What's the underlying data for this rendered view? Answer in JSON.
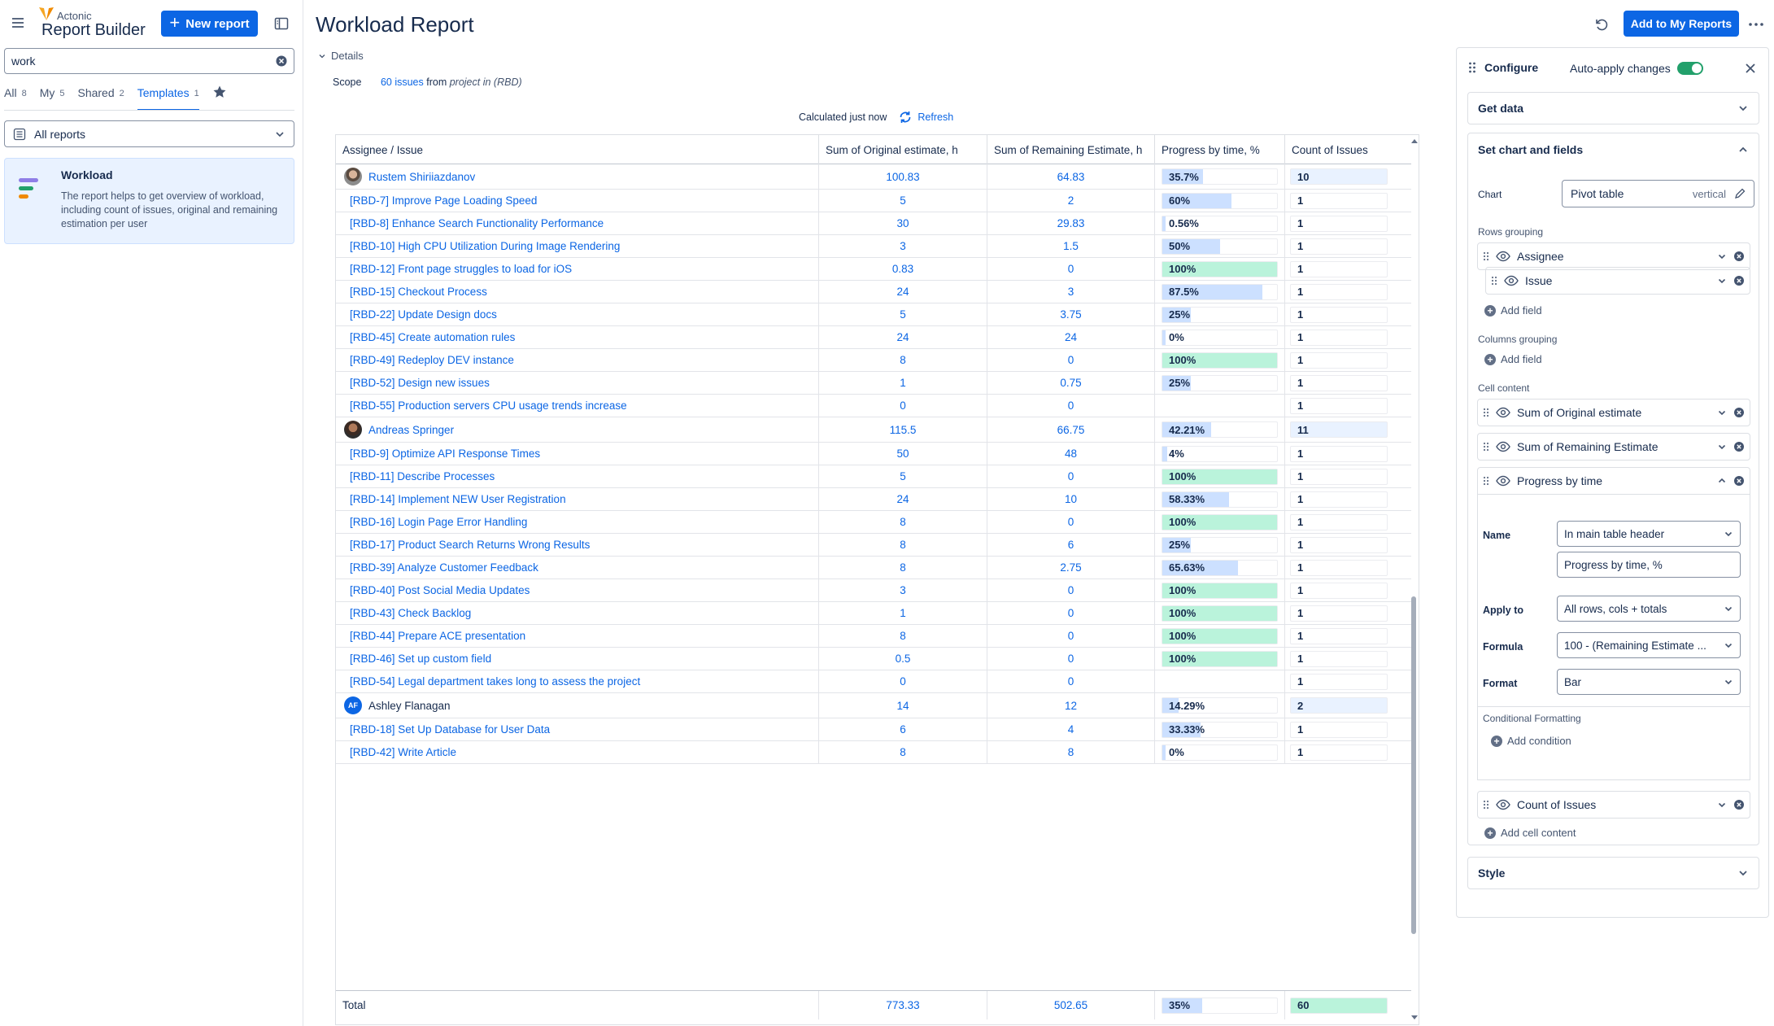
{
  "brand": {
    "small": "Actonic",
    "title": "Report Builder"
  },
  "sidebar": {
    "new_report": "New report",
    "search_value": "work",
    "tabs": [
      {
        "label": "All",
        "count": "8"
      },
      {
        "label": "My",
        "count": "5"
      },
      {
        "label": "Shared",
        "count": "2"
      },
      {
        "label": "Templates",
        "count": "1"
      }
    ],
    "filter": "All reports",
    "card": {
      "title": "Workload",
      "description": "The report helps to get overview of workload, including count of issues, original and remaining estimation per user"
    }
  },
  "header": {
    "title": "Workload Report",
    "add_button": "Add to My Reports",
    "details": "Details",
    "scope_label": "Scope",
    "scope_link": "60 issues",
    "scope_from": "from",
    "scope_project": "project in (RBD)",
    "calculated": "Calculated just now",
    "refresh": "Refresh"
  },
  "table": {
    "columns": [
      "Assignee / Issue",
      "Sum of Original estimate, h",
      "Sum of Remaining Estimate, h",
      "Progress by time, %",
      "Count of Issues"
    ],
    "rows": [
      {
        "type": "assignee",
        "name": "Rustem Shiriiazdanov",
        "avatar": "photo1",
        "orig": "100.83",
        "rem": "64.83",
        "prog": "35.7%",
        "pct": 35.7,
        "count": "10"
      },
      {
        "type": "issue",
        "name": "[RBD-7] Improve Page Loading Speed",
        "orig": "5",
        "rem": "2",
        "prog": "60%",
        "pct": 60,
        "count": "1"
      },
      {
        "type": "issue",
        "name": "[RBD-8] Enhance Search Functionality Performance",
        "orig": "30",
        "rem": "29.83",
        "prog": "0.56%",
        "pct": 0.56,
        "count": "1"
      },
      {
        "type": "issue",
        "name": "[RBD-10] High CPU Utilization During Image Rendering",
        "orig": "3",
        "rem": "1.5",
        "prog": "50%",
        "pct": 50,
        "count": "1"
      },
      {
        "type": "issue",
        "name": "[RBD-12] Front page struggles to load for iOS",
        "orig": "0.83",
        "rem": "0",
        "prog": "100%",
        "pct": 100,
        "count": "1"
      },
      {
        "type": "issue",
        "name": "[RBD-15] Checkout Process",
        "orig": "24",
        "rem": "3",
        "prog": "87.5%",
        "pct": 87.5,
        "count": "1"
      },
      {
        "type": "issue",
        "name": "[RBD-22] Update Design docs",
        "orig": "5",
        "rem": "3.75",
        "prog": "25%",
        "pct": 25,
        "count": "1"
      },
      {
        "type": "issue",
        "name": "[RBD-45] Create automation rules",
        "orig": "24",
        "rem": "24",
        "prog": "0%",
        "pct": 0,
        "count": "1"
      },
      {
        "type": "issue",
        "name": "[RBD-49] Redeploy DEV instance",
        "orig": "8",
        "rem": "0",
        "prog": "100%",
        "pct": 100,
        "count": "1"
      },
      {
        "type": "issue",
        "name": "[RBD-52] Design new issues",
        "orig": "1",
        "rem": "0.75",
        "prog": "25%",
        "pct": 25,
        "count": "1"
      },
      {
        "type": "issue",
        "name": "[RBD-55] Production servers CPU usage trends increase",
        "orig": "0",
        "rem": "0",
        "prog": "",
        "pct": null,
        "count": "1"
      },
      {
        "type": "assignee",
        "name": "Andreas Springer",
        "avatar": "photo2",
        "orig": "115.5",
        "rem": "66.75",
        "prog": "42.21%",
        "pct": 42.21,
        "count": "11"
      },
      {
        "type": "issue",
        "name": "[RBD-9] Optimize API Response Times",
        "orig": "50",
        "rem": "48",
        "prog": "4%",
        "pct": 4,
        "count": "1"
      },
      {
        "type": "issue",
        "name": "[RBD-11] Describe Processes",
        "orig": "5",
        "rem": "0",
        "prog": "100%",
        "pct": 100,
        "count": "1"
      },
      {
        "type": "issue",
        "name": "[RBD-14] Implement NEW User Registration",
        "orig": "24",
        "rem": "10",
        "prog": "58.33%",
        "pct": 58.33,
        "count": "1"
      },
      {
        "type": "issue",
        "name": "[RBD-16] Login Page Error Handling",
        "orig": "8",
        "rem": "0",
        "prog": "100%",
        "pct": 100,
        "count": "1"
      },
      {
        "type": "issue",
        "name": "[RBD-17] Product Search Returns Wrong Results",
        "orig": "8",
        "rem": "6",
        "prog": "25%",
        "pct": 25,
        "count": "1"
      },
      {
        "type": "issue",
        "name": "[RBD-39] Analyze Customer Feedback",
        "orig": "8",
        "rem": "2.75",
        "prog": "65.63%",
        "pct": 65.63,
        "count": "1"
      },
      {
        "type": "issue",
        "name": "[RBD-40] Post Social Media Updates",
        "orig": "3",
        "rem": "0",
        "prog": "100%",
        "pct": 100,
        "count": "1"
      },
      {
        "type": "issue",
        "name": "[RBD-43] Check Backlog",
        "orig": "1",
        "rem": "0",
        "prog": "100%",
        "pct": 100,
        "count": "1"
      },
      {
        "type": "issue",
        "name": "[RBD-44] Prepare ACE presentation",
        "orig": "8",
        "rem": "0",
        "prog": "100%",
        "pct": 100,
        "count": "1"
      },
      {
        "type": "issue",
        "name": "[RBD-46] Set up custom field",
        "orig": "0.5",
        "rem": "0",
        "prog": "100%",
        "pct": 100,
        "count": "1"
      },
      {
        "type": "issue",
        "name": "[RBD-54] Legal department takes long to assess the project",
        "orig": "0",
        "rem": "0",
        "prog": "",
        "pct": null,
        "count": "1"
      },
      {
        "type": "assignee",
        "name": "Ashley Flanagan",
        "avatar": "AF",
        "orig": "14",
        "rem": "12",
        "prog": "14.29%",
        "pct": 14.29,
        "count": "2"
      },
      {
        "type": "issue",
        "name": "[RBD-18] Set Up Database for User Data",
        "orig": "6",
        "rem": "4",
        "prog": "33.33%",
        "pct": 33.33,
        "count": "1"
      },
      {
        "type": "issue",
        "name": "[RBD-42] Write Article",
        "orig": "8",
        "rem": "8",
        "prog": "0%",
        "pct": 0,
        "count": "1"
      }
    ],
    "total": {
      "label": "Total",
      "orig": "773.33",
      "rem": "502.65",
      "prog": "35%",
      "pct": 35,
      "count": "60"
    }
  },
  "config": {
    "title": "Configure",
    "auto_apply": "Auto-apply changes",
    "get_data": "Get data",
    "set_chart": "Set chart and fields",
    "chart_label": "Chart",
    "chart_value": "Pivot table",
    "chart_orientation": "vertical",
    "rows_grouping": "Rows grouping",
    "row_fields": [
      "Assignee",
      "Issue"
    ],
    "add_field": "Add field",
    "columns_grouping": "Columns grouping",
    "cell_content": "Cell content",
    "cell_fields": [
      "Sum of Original estimate",
      "Sum of Remaining Estimate",
      "Progress by time"
    ],
    "name_label": "Name",
    "name_select": "In main table header",
    "name_value": "Progress by time, %",
    "apply_label": "Apply to",
    "apply_value": "All rows, cols + totals",
    "formula_label": "Formula",
    "formula_value": "100 - (Remaining Estimate ...",
    "format_label": "Format",
    "format_value": "Bar",
    "cond_label": "Conditional Formatting",
    "add_condition": "Add condition",
    "count_field": "Count of Issues",
    "add_cell": "Add cell content",
    "style": "Style"
  },
  "colors": {
    "primary": "#0c66e4",
    "bar_blue": "#cce0ff",
    "bar_green": "#baf3db",
    "toggle_green": "#22a06b"
  }
}
